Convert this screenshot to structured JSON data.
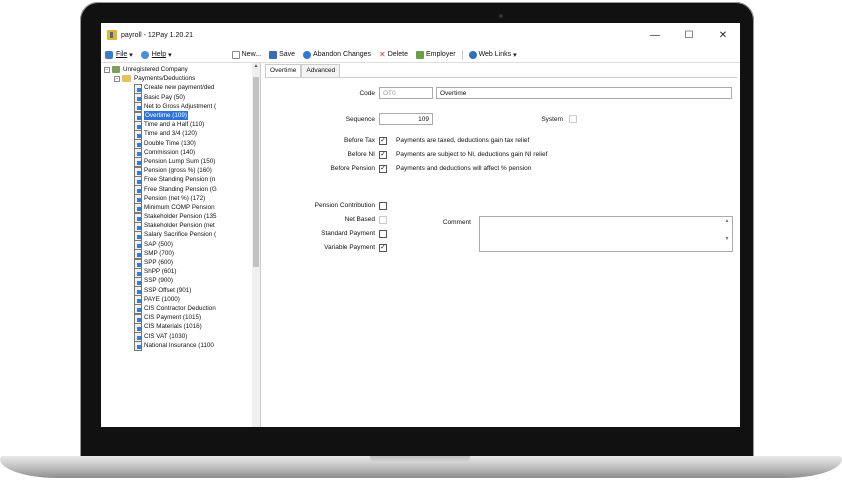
{
  "window": {
    "title": "payroll - 12Pay 1.20.21",
    "minimize": "—",
    "maximize": "☐",
    "close": "✕"
  },
  "menu": {
    "file": "File",
    "help": "Help"
  },
  "toolbar": {
    "new": "New...",
    "save": "Save",
    "abandon": "Abandon Changes",
    "delete": "Delete",
    "employer": "Employer",
    "web_links": "Web Links"
  },
  "tree": {
    "root": "Unregistered Company",
    "folder": "Payments/Deductions",
    "items": [
      "Create new payment/ded",
      "Basic Pay (50)",
      "Net to Gross Adjustment (",
      "Overtime (109)",
      "Time and a Half (110)",
      "Time and 3/4 (120)",
      "Double Time (130)",
      "Commission (140)",
      "Pension Lump Sum (150)",
      "Pension (gross %) (160)",
      "Free Standing Pension (n",
      "Free Standing Pension (G",
      "Pension (net %) (172)",
      "Minimum COMP Pension",
      "Stakeholder Pension (135",
      "Stakeholder Pension (net",
      "Salary Sacrifice Pension (",
      "SAP (500)",
      "SMP (700)",
      "SPP (600)",
      "ShPP (601)",
      "SSP (900)",
      "SSP Offset (901)",
      "PAYE (1000)",
      "CIS Contractor Deduction",
      "CIS Payment (1015)",
      "CIS Materials (1016)",
      "CIS VAT (1030)",
      "National Insurance (1100"
    ],
    "selected_index": 3
  },
  "tabs": [
    "Overtime",
    "Advanced"
  ],
  "form": {
    "code_label": "Code",
    "code_value": "OT0",
    "name_value": "Overtime",
    "sequence_label": "Sequence",
    "sequence_value": "109",
    "system_label": "System",
    "before_tax_label": "Before Tax",
    "before_tax_note": "Payments are taxed, deductions gain tax relief",
    "before_ni_label": "Before NI",
    "before_ni_note": "Payments are subject to NI, deductions gain NI relief",
    "before_pension_label": "Before Pension",
    "before_pension_note": "Payments and deductions will affect % pension",
    "pension_contribution_label": "Pension Contribution",
    "net_based_label": "Net Based",
    "standard_payment_label": "Standard Payment",
    "variable_payment_label": "Variable Payment",
    "comment_label": "Comment",
    "checks": {
      "system": false,
      "before_tax": true,
      "before_ni": true,
      "before_pension": true,
      "pension_contribution": false,
      "net_based": false,
      "standard_payment": false,
      "variable_payment": true
    }
  },
  "colors": {
    "selection": "#2f72d6"
  }
}
